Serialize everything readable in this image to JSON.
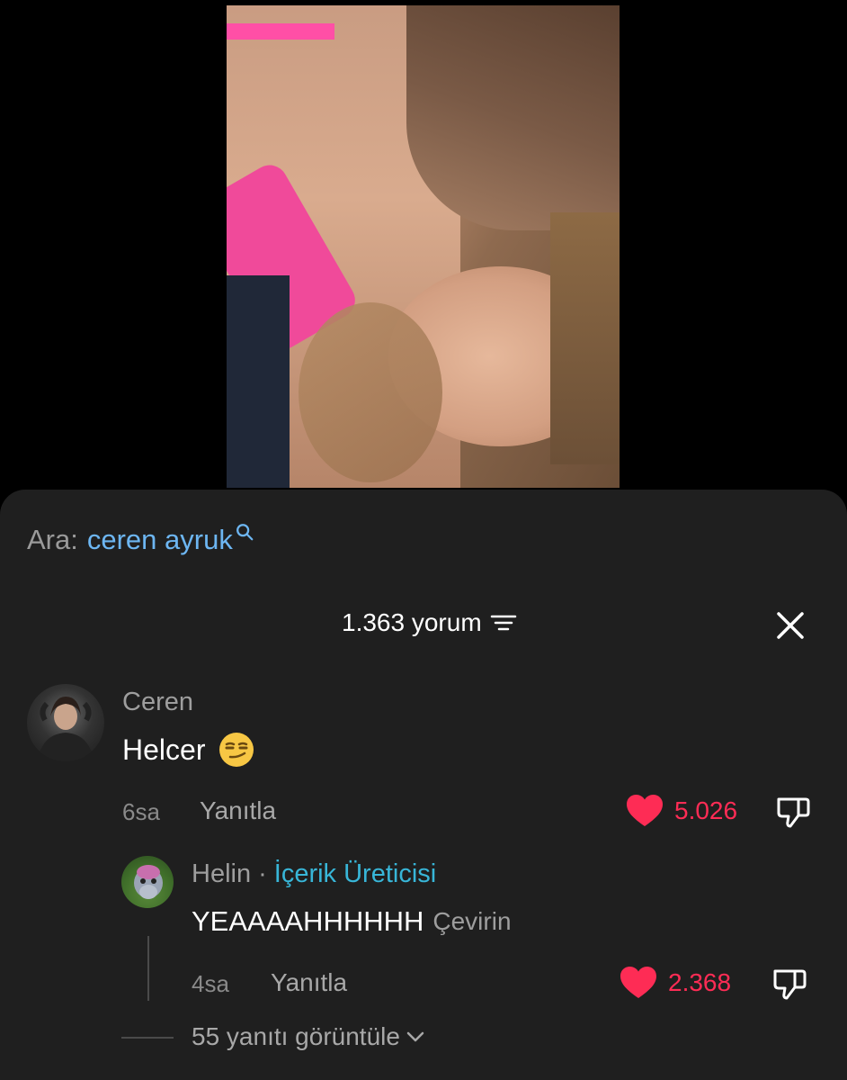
{
  "search": {
    "prefix": "Ara:",
    "term": "ceren ayruk"
  },
  "comments_header": {
    "count_label": "1.363 yorum"
  },
  "comment": {
    "username": "Ceren",
    "text": "Helcer",
    "emoji_icon": "smirk-emoji",
    "time": "6sa",
    "reply_label": "Yanıtla",
    "likes": "5.026"
  },
  "reply": {
    "username": "Helin",
    "badge": "İçerik Üreticisi",
    "separator": "·",
    "text": "YEAAAAHHHHHH",
    "translate_label": "Çevirin",
    "time": "4sa",
    "reply_label": "Yanıtla",
    "likes": "2.368"
  },
  "view_replies": {
    "label": "55 yanıtı görüntüle"
  },
  "colors": {
    "sheet_bg": "#1f1f1f",
    "like_red": "#fe2c55",
    "search_blue": "#6db6f2",
    "creator_blue": "#38b6d8"
  }
}
